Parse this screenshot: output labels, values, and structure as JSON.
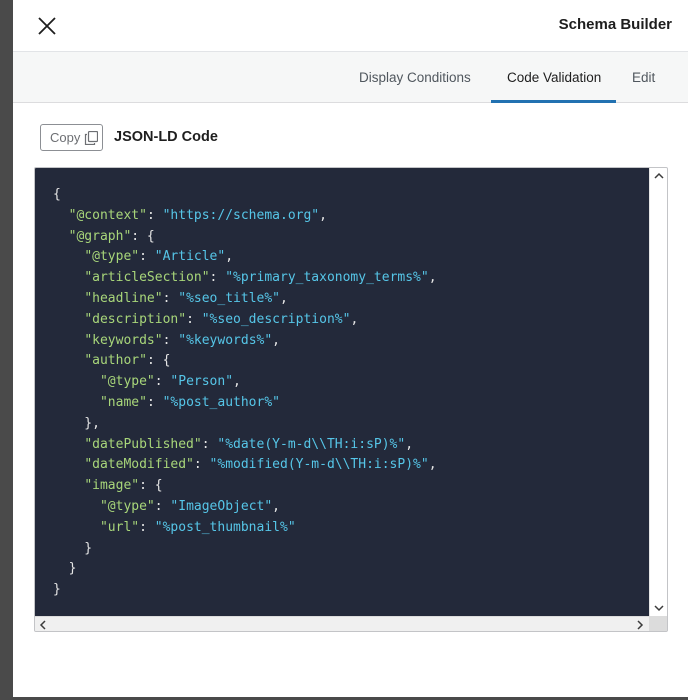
{
  "header": {
    "title": "Schema Builder",
    "close_icon": "close-icon"
  },
  "tabs": [
    {
      "label": "Display Conditions",
      "active": false
    },
    {
      "label": "Code Validation",
      "active": true
    },
    {
      "label": "Edit",
      "active": false
    }
  ],
  "toolbar": {
    "copy_label": "Copy",
    "copy_icon": "copy-icon",
    "section_title": "JSON-LD Code"
  },
  "code": {
    "lines": [
      [
        {
          "t": "p",
          "v": "{"
        }
      ],
      [
        {
          "t": "p",
          "v": "  "
        },
        {
          "t": "k",
          "v": "\"@context\""
        },
        {
          "t": "p",
          "v": ": "
        },
        {
          "t": "s",
          "v": "\"https://schema.org\""
        },
        {
          "t": "p",
          "v": ","
        }
      ],
      [
        {
          "t": "p",
          "v": "  "
        },
        {
          "t": "k",
          "v": "\"@graph\""
        },
        {
          "t": "p",
          "v": ": {"
        }
      ],
      [
        {
          "t": "p",
          "v": "    "
        },
        {
          "t": "k",
          "v": "\"@type\""
        },
        {
          "t": "p",
          "v": ": "
        },
        {
          "t": "s",
          "v": "\"Article\""
        },
        {
          "t": "p",
          "v": ","
        }
      ],
      [
        {
          "t": "p",
          "v": "    "
        },
        {
          "t": "k",
          "v": "\"articleSection\""
        },
        {
          "t": "p",
          "v": ": "
        },
        {
          "t": "s",
          "v": "\"%primary_taxonomy_terms%\""
        },
        {
          "t": "p",
          "v": ","
        }
      ],
      [
        {
          "t": "p",
          "v": "    "
        },
        {
          "t": "k",
          "v": "\"headline\""
        },
        {
          "t": "p",
          "v": ": "
        },
        {
          "t": "s",
          "v": "\"%seo_title%\""
        },
        {
          "t": "p",
          "v": ","
        }
      ],
      [
        {
          "t": "p",
          "v": "    "
        },
        {
          "t": "k",
          "v": "\"description\""
        },
        {
          "t": "p",
          "v": ": "
        },
        {
          "t": "s",
          "v": "\"%seo_description%\""
        },
        {
          "t": "p",
          "v": ","
        }
      ],
      [
        {
          "t": "p",
          "v": "    "
        },
        {
          "t": "k",
          "v": "\"keywords\""
        },
        {
          "t": "p",
          "v": ": "
        },
        {
          "t": "s",
          "v": "\"%keywords%\""
        },
        {
          "t": "p",
          "v": ","
        }
      ],
      [
        {
          "t": "p",
          "v": "    "
        },
        {
          "t": "k",
          "v": "\"author\""
        },
        {
          "t": "p",
          "v": ": {"
        }
      ],
      [
        {
          "t": "p",
          "v": "      "
        },
        {
          "t": "k",
          "v": "\"@type\""
        },
        {
          "t": "p",
          "v": ": "
        },
        {
          "t": "s",
          "v": "\"Person\""
        },
        {
          "t": "p",
          "v": ","
        }
      ],
      [
        {
          "t": "p",
          "v": "      "
        },
        {
          "t": "k",
          "v": "\"name\""
        },
        {
          "t": "p",
          "v": ": "
        },
        {
          "t": "s",
          "v": "\"%post_author%\""
        }
      ],
      [
        {
          "t": "p",
          "v": "    },"
        }
      ],
      [
        {
          "t": "p",
          "v": "    "
        },
        {
          "t": "k",
          "v": "\"datePublished\""
        },
        {
          "t": "p",
          "v": ": "
        },
        {
          "t": "s",
          "v": "\"%date(Y-m-d\\\\TH:i:sP)%\""
        },
        {
          "t": "p",
          "v": ","
        }
      ],
      [
        {
          "t": "p",
          "v": "    "
        },
        {
          "t": "k",
          "v": "\"dateModified\""
        },
        {
          "t": "p",
          "v": ": "
        },
        {
          "t": "s",
          "v": "\"%modified(Y-m-d\\\\TH:i:sP)%\""
        },
        {
          "t": "p",
          "v": ","
        }
      ],
      [
        {
          "t": "p",
          "v": "    "
        },
        {
          "t": "k",
          "v": "\"image\""
        },
        {
          "t": "p",
          "v": ": {"
        }
      ],
      [
        {
          "t": "p",
          "v": "      "
        },
        {
          "t": "k",
          "v": "\"@type\""
        },
        {
          "t": "p",
          "v": ": "
        },
        {
          "t": "s",
          "v": "\"ImageObject\""
        },
        {
          "t": "p",
          "v": ","
        }
      ],
      [
        {
          "t": "p",
          "v": "      "
        },
        {
          "t": "k",
          "v": "\"url\""
        },
        {
          "t": "p",
          "v": ": "
        },
        {
          "t": "s",
          "v": "\"%post_thumbnail%\""
        }
      ],
      [
        {
          "t": "p",
          "v": "    }"
        }
      ],
      [
        {
          "t": "p",
          "v": "  }"
        }
      ],
      [
        {
          "t": "p",
          "v": "}"
        }
      ]
    ]
  },
  "colors": {
    "accent": "#2271b1",
    "code_bg": "#23293a",
    "code_key": "#a8d67a",
    "code_string": "#56c6e8"
  }
}
